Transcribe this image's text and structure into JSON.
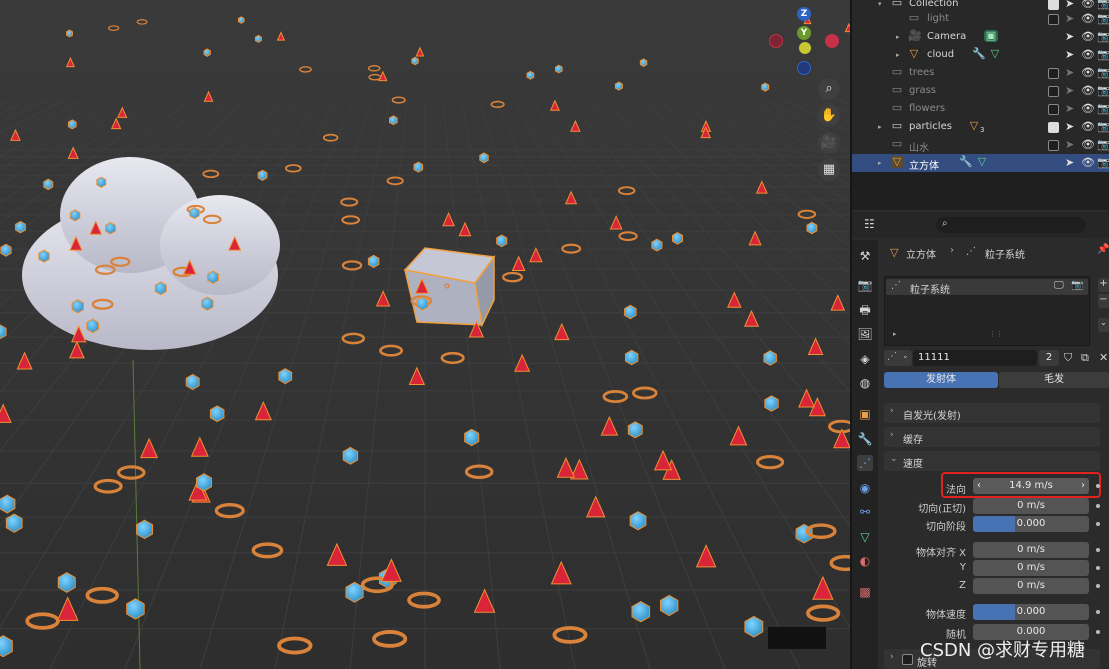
{
  "outliner": {
    "rows": [
      {
        "name": "Collection",
        "dim": false
      },
      {
        "name": "light",
        "dim": true
      },
      {
        "name": "Camera",
        "dim": false
      },
      {
        "name": "cloud",
        "dim": false
      },
      {
        "name": "trees",
        "dim": true
      },
      {
        "name": "grass",
        "dim": true
      },
      {
        "name": "flowers",
        "dim": true
      },
      {
        "name": "particles",
        "dim": false
      },
      {
        "name": "山水",
        "dim": true
      },
      {
        "name": "立方体",
        "dim": false
      }
    ],
    "particles_badge": "3"
  },
  "breadcrumb": {
    "object": "立方体",
    "section": "粒子系统"
  },
  "particle_list": {
    "item": "粒子系统"
  },
  "settings": {
    "name": "11111",
    "users": "2"
  },
  "type_tabs": {
    "emitter": "发射体",
    "hair": "毛发"
  },
  "panels": {
    "emission": "自发光(发射)",
    "cache": "缓存",
    "velocity": "速度",
    "rotation": "旋转"
  },
  "velocity": {
    "normal_label": "法向",
    "normal_value": "14.9 m/s",
    "tangent_label": "切向(正切)",
    "tangent_value": "0 m/s",
    "tangent_phase_label": "切向阶段",
    "tangent_phase_value": "0.000",
    "align_x_label": "物体对齐 X",
    "align_x_value": "0 m/s",
    "align_y_label": "Y",
    "align_y_value": "0 m/s",
    "align_z_label": "Z",
    "align_z_value": "0 m/s",
    "object_velocity_label": "物体速度",
    "object_velocity_value": "0.000",
    "random_label": "随机",
    "random_value": "0.000"
  },
  "gizmo": {
    "z": "Z",
    "y": "Y"
  },
  "watermark": "CSDN @求财专用糖",
  "colors": {
    "selected": "#334d80",
    "accent_blue": "#4772b3",
    "highlight_red": "#e0231c",
    "orange": "#e8a14a"
  }
}
